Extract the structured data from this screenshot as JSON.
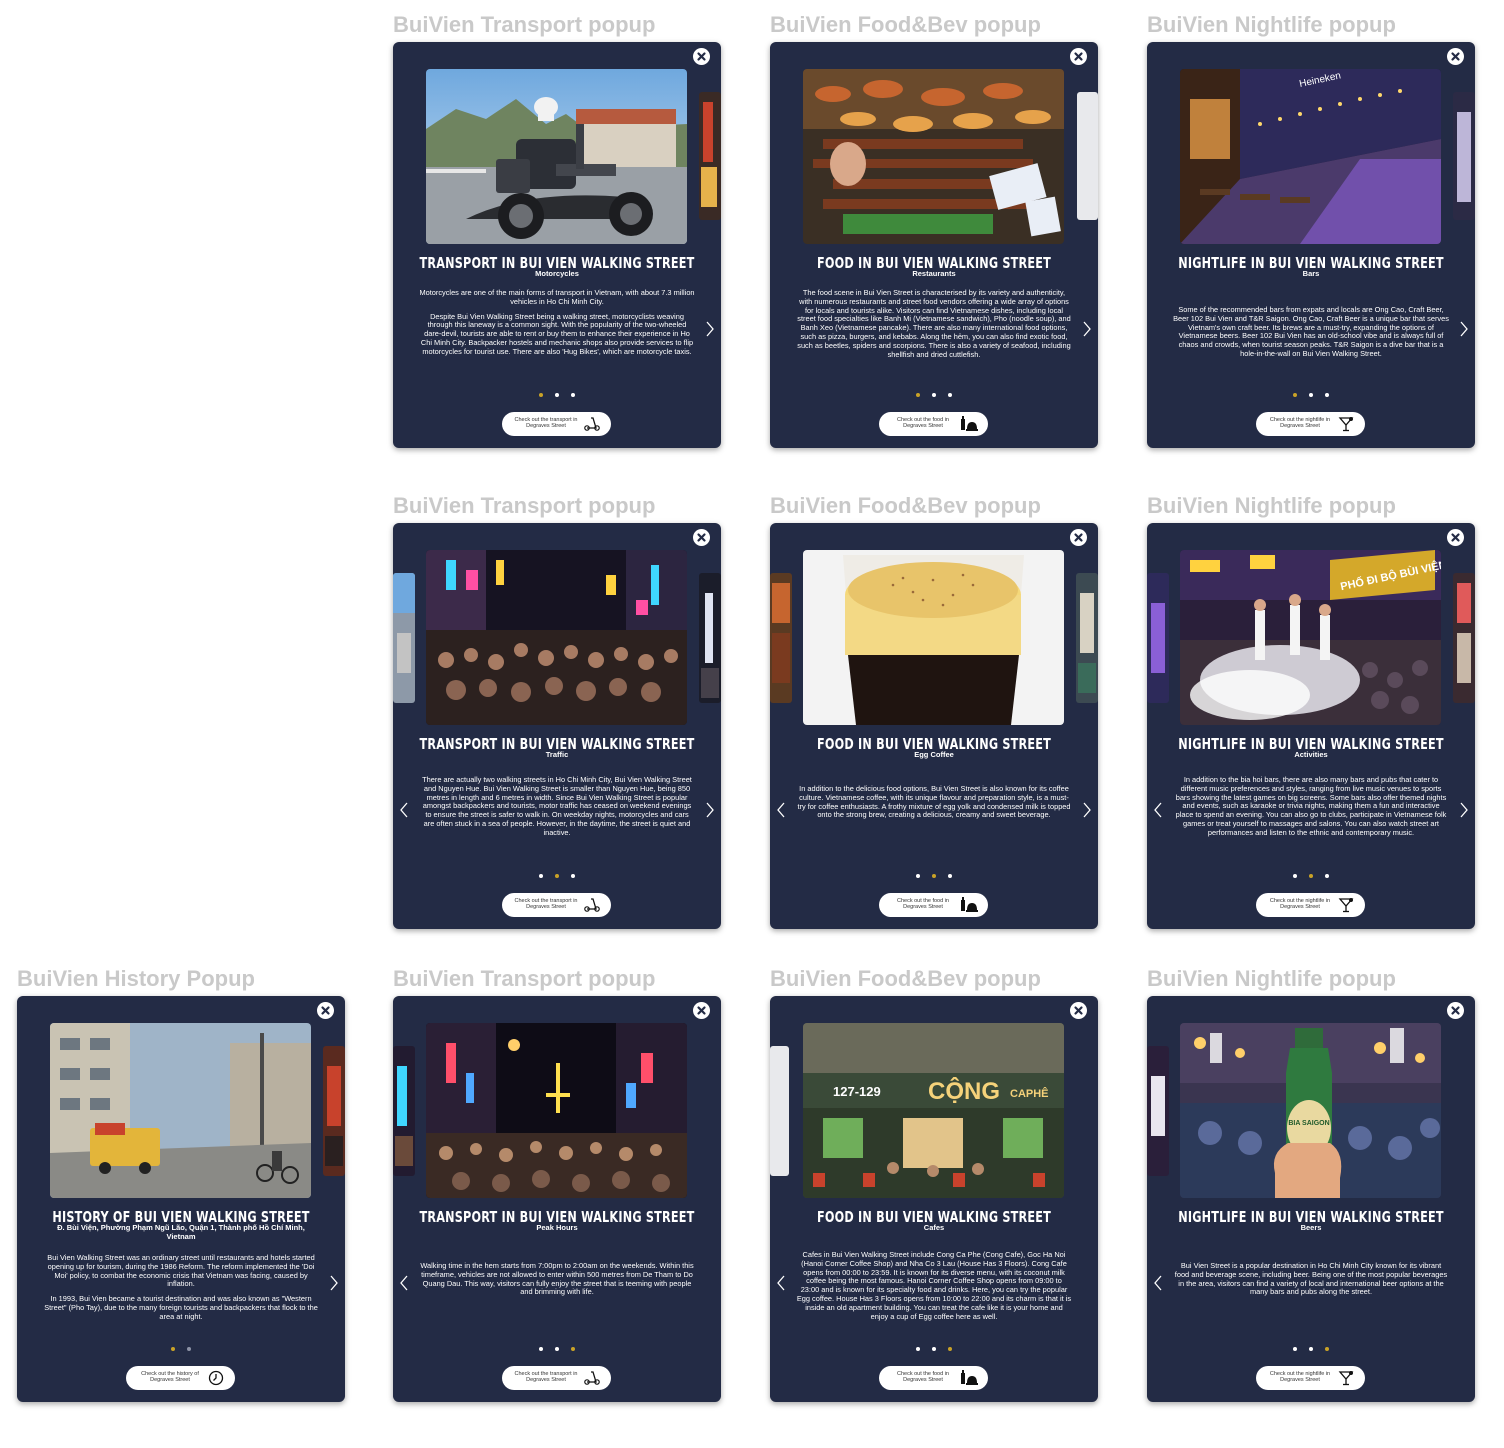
{
  "labels": {
    "transport": "BuiVien Transport popup",
    "food": "BuiVien Food&Bev popup",
    "nightlife": "BuiVien Nightlife popup",
    "history": "BuiVien History Popup"
  },
  "common": {
    "transport_title": "TRANSPORT IN BUI VIEN WALKING STREET",
    "food_title": "FOOD IN BUI VIEN WALKING STREET",
    "nightlife_title": "NIGHTLIFE IN BUI VIEN WALKING STREET",
    "history_title": "HISTORY OF BUI VIEN WALKING STREET",
    "cta_transport": "Check out the transport in Degraves Street",
    "cta_food": "Check out the food in Degraves Street",
    "cta_nightlife": "Check out the nightlife in Degraves Street",
    "cta_history": "Check out the history of Degraves Street"
  },
  "cards": {
    "t1": {
      "subtitle": "Motorcycles",
      "p1": "Motorcycles are one of the main forms of transport in Vietnam, with about 7.3 million vehicles in Ho Chi Minh City.",
      "p2": "Despite Bui Vien Walking Street being a walking street, motorcyclists weaving through this laneway is a common sight. With the popularity of the two-wheeled dare-devil, tourists are able to rent or buy them to enhance their experience in Ho Chi Minh City. Backpacker hostels and mechanic shops also provide services to flip motorcycles for tourist use. There are also 'Hug Bikes', which are motorcycle taxis."
    },
    "f1": {
      "subtitle": "Restaurants",
      "p1": "The food scene in Bui Vien Street is characterised by its variety and authenticity, with numerous restaurants and street food vendors offering a wide array of options for locals and tourists alike. Visitors can find Vietnamese dishes, including local street food specialties like Banh Mi (Vietnamese sandwich), Pho (noodle soup), and Banh Xeo (Vietnamese pancake). There are also many international food options, such as pizza, burgers, and kebabs. Along the hẻm, you can also find exotic food, such as beetles, spiders and scorpions. There is also a variety of seafood, including shellfish and dried cuttlefish."
    },
    "n1": {
      "subtitle": "Bars",
      "p1": "Some of the recommended bars from expats and locals are Ong Cao, Craft Beer, Beer 102 Bui Vien and T&R Saigon. Ong Cao, Craft Beer is a unique bar that serves Vietnam's own craft beer. Its brews are a must-try, expanding the options of Vietnamese beers. Beer 102 Bui Vien has an old-school vibe and is always full of chaos and crowds, when tourist season peaks. T&R Saigon is a dive bar that is a hole-in-the-wall on Bui Vien Walking Street."
    },
    "t2": {
      "subtitle": "Traffic",
      "p1": "There are actually two walking streets in Ho Chi Minh City, Bui Vien Walking Street and Nguyen Hue. Bui Vien Walking Street is smaller than Nguyen Hue, being 850 metres in length and 6 metres in width. Since Bui Vien Walking Street is popular amongst backpackers and tourists, motor traffic has ceased on weekend evenings to ensure the street is safer to walk in. On weekday nights, motorcycles and cars are often stuck in a sea of people. However, in the daytime, the street is quiet and inactive."
    },
    "f2": {
      "subtitle": "Egg Coffee",
      "p1": "In addition to the delicious food options, Bui Vien Street is also known for its coffee culture. Vietnamese coffee, with its unique flavour and preparation style, is a must-try for coffee enthusiasts. A frothy mixture of egg yolk and condensed milk is topped onto the strong brew, creating a delicious, creamy and sweet beverage."
    },
    "n2": {
      "subtitle": "Activities",
      "p1": "In addition to the bia hoi bars, there are also many bars and pubs that cater to different music preferences and styles, ranging from live music venues to sports bars showing the latest games on big screens. Some bars also offer themed nights and events, such as karaoke or trivia nights, making them a fun and interactive place to spend an evening. You can also go to clubs, participate in Vietnamese folk games or treat yourself to massages and salons. You can also watch street art performances and listen to the ethnic and contemporary music."
    },
    "h1": {
      "subtitle": "Đ. Bùi Viện, Phường Phạm Ngũ Lão, Quận 1, Thành phố Hồ Chí Minh, Vietnam",
      "p1": "Bui Vien Walking Street was an ordinary street until restaurants and hotels started opening up for tourism, during the 1986 Reform. The reform implemented the 'Doi Moi' policy, to combat the economic crisis that Vietnam was facing, caused by inflation.",
      "p2": "In 1993, Bui Vien became a tourist destination and was also known as \"Western Street\" (Pho Tay), due to the many foreign tourists and backpackers that flock to the area at night."
    },
    "t3": {
      "subtitle": "Peak Hours",
      "p1": "Walking time in the hem starts from 7:00pm to 2:00am on the weekends. Within this timeframe, vehicles are not allowed to enter within 500 metres from De Tham to Do Quang Dau. This way, visitors can fully enjoy the street that is teeming with people and brimming with life."
    },
    "f3": {
      "subtitle": "Cafes",
      "p1": "Cafes in Bui Vien Walking Street include Cong Ca Phe (Cong Cafe), Goc Ha Noi (Hanoi Corner Coffee Shop) and Nha Co 3 Lau (House Has 3 Floors). Cong Cafe opens from 00:00 to 23:59. It is known for its diverse menu, with its coconut milk coffee being the most famous. Hanoi Corner Coffee Shop opens from 09:00 to 23:00 and is known for its specialty food and drinks. Here, you can try the popular Egg coffee. House Has 3 Floors opens from 10:00 to 22:00 and its charm is that it is inside an old apartment building. You can treat the cafe like it is your home and enjoy a cup of Egg coffee here as well.",
      "sign_number": "127-129",
      "sign_name": "CỘNG",
      "sign_sub": "CAPHÊ"
    },
    "n3": {
      "subtitle": "Beers",
      "p1": "Bui Vien Street is a popular destination in Ho Chi Minh City known for its vibrant food and beverage scene, including beer. Being one of the most popular beverages in the area, visitors can find a variety of local and international beer options at the many bars and pubs along the street.",
      "bottle_label": "BIA SAIGON"
    }
  }
}
